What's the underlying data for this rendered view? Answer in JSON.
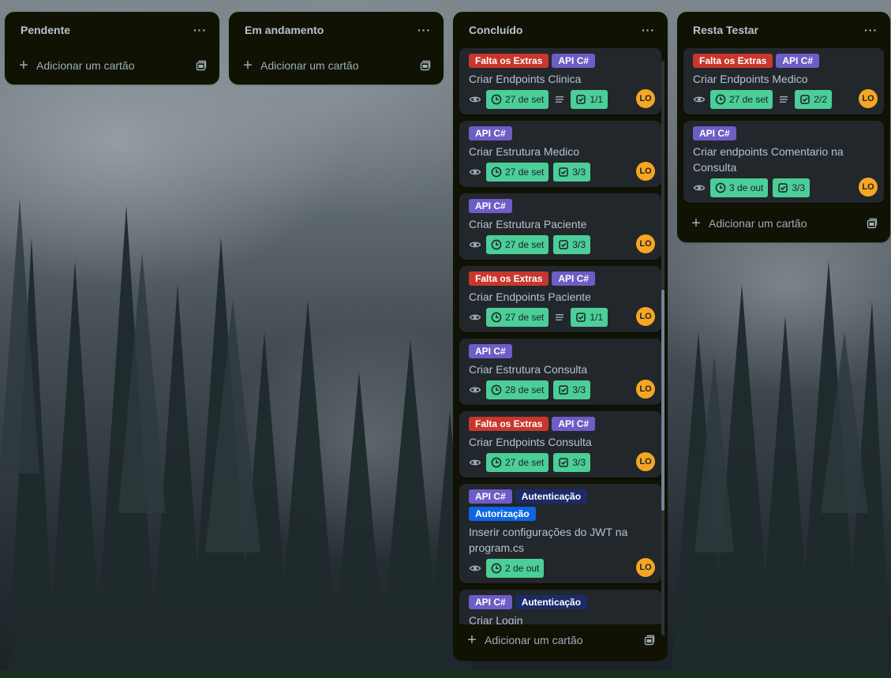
{
  "colors": {
    "label_red": "#c9372c",
    "label_purple": "#6e5dc6",
    "label_navy": "#1c2b67",
    "label_blue": "#0c66e4",
    "chip_green": "#4bce97",
    "avatar_orange": "#f5a623"
  },
  "add_card_label": "Adicionar um cartão",
  "lists": [
    {
      "title": "Pendente",
      "menu": "···"
    },
    {
      "title": "Em andamento",
      "menu": "···"
    },
    {
      "title": "Concluído",
      "menu": "···"
    },
    {
      "title": "Resta Testar",
      "menu": "···"
    }
  ],
  "concluido_cards": [
    {
      "labels": [
        "Falta os Extras",
        "API C#"
      ],
      "title": "Criar Endpoints Clinica",
      "date": "27 de set",
      "checklist": "1/1",
      "avatar": "LO"
    },
    {
      "labels": [
        "API C#"
      ],
      "title": "Criar Estrutura Medico",
      "date": "27 de set",
      "checklist": "3/3",
      "avatar": "LO"
    },
    {
      "labels": [
        "API C#"
      ],
      "title": "Criar Estrutura Paciente",
      "date": "27 de set",
      "checklist": "3/3",
      "avatar": "LO"
    },
    {
      "labels": [
        "Falta os Extras",
        "API C#"
      ],
      "title": "Criar Endpoints Paciente",
      "date": "27 de set",
      "checklist": "1/1",
      "avatar": "LO"
    },
    {
      "labels": [
        "API C#"
      ],
      "title": "Criar Estrutura Consulta",
      "date": "28 de set",
      "checklist": "3/3",
      "avatar": "LO"
    },
    {
      "labels": [
        "Falta os Extras",
        "API C#"
      ],
      "title": "Criar Endpoints Consulta",
      "date": "27 de set",
      "checklist": "3/3",
      "avatar": "LO"
    },
    {
      "labels": [
        "API C#",
        "Autenticação",
        "Autorização"
      ],
      "title": "Inserir configurações do JWT na program.cs",
      "date": "2 de out",
      "avatar": "LO"
    },
    {
      "labels": [
        "API C#",
        "Autenticação"
      ],
      "title": "Criar Login"
    }
  ],
  "resta_cards": [
    {
      "labels": [
        "Falta os Extras",
        "API C#"
      ],
      "title": "Criar Endpoints Medico",
      "date": "27 de set",
      "checklist": "2/2",
      "avatar": "LO"
    },
    {
      "labels": [
        "API C#"
      ],
      "title": "Criar endpoints Comentario na Consulta",
      "date": "3 de out",
      "checklist": "3/3",
      "avatar": "LO"
    }
  ]
}
